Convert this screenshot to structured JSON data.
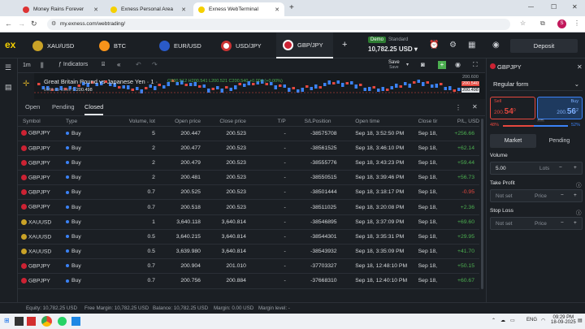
{
  "browser": {
    "tabs": [
      {
        "title": "Money Rains Forever",
        "color": "#d33"
      },
      {
        "title": "Exness Personal Area",
        "color": "#f5d000"
      },
      {
        "title": "Exness WebTerminal",
        "color": "#f5d000"
      }
    ],
    "new_tab": "+",
    "url": "my.exness.com/webtrading/",
    "profile_initial": "S"
  },
  "header": {
    "logo": "ex",
    "instruments": [
      {
        "name": "XAU/USD",
        "color": "#c9a227"
      },
      {
        "name": "BTC",
        "color": "#f7931a"
      },
      {
        "name": "EUR/USD",
        "color": "#2a5ac7"
      },
      {
        "name": "USD/JPY",
        "color": "#ffffff"
      },
      {
        "name": "GBP/JPY",
        "color": "#cc2233"
      }
    ],
    "add": "+",
    "account_type": "Demo",
    "account_kind": "Standard",
    "balance": "10,782.25 USD",
    "deposit": "Deposit"
  },
  "chart": {
    "interval": "1m",
    "indicators": "Indicators",
    "save": "Save",
    "save_sub": "Save",
    "title": "Great Britain Pound vs Japanese Yen · 1 ·",
    "ohlc": "O200.512 H200.541 L200.521 C200.540 +0.004 (+0.00%)",
    "ema": "EMA no close 9",
    "ema_value": "200.498",
    "price_top": "200.600",
    "price_red": "200.540",
    "price_white": "200.498"
  },
  "orders": {
    "tabs": [
      "Open",
      "Pending",
      "Closed"
    ],
    "active_tab": "Closed",
    "columns": [
      "Symbol",
      "Type",
      "Volume, lot",
      "Open price",
      "Close price",
      "T/P",
      "S/L",
      "Position",
      "Open time",
      "Close tir",
      "P/L, USD"
    ],
    "rows": [
      [
        "GBPJPY",
        "Buy",
        "5",
        "200.447",
        "200.523",
        "-",
        "-",
        "38575708",
        "Sep 18, 3:52:50 PM",
        "Sep 18,",
        "+256.66"
      ],
      [
        "GBPJPY",
        "Buy",
        "2",
        "200.477",
        "200.523",
        "-",
        "-",
        "38561525",
        "Sep 18, 3:46:10 PM",
        "Sep 18,",
        "+62.14"
      ],
      [
        "GBPJPY",
        "Buy",
        "2",
        "200.479",
        "200.523",
        "-",
        "-",
        "38555776",
        "Sep 18, 3:43:23 PM",
        "Sep 18,",
        "+59.44"
      ],
      [
        "GBPJPY",
        "Buy",
        "2",
        "200.481",
        "200.523",
        "-",
        "-",
        "38550515",
        "Sep 18, 3:39:46 PM",
        "Sep 18,",
        "+56.73"
      ],
      [
        "GBPJPY",
        "Buy",
        "0.7",
        "200.525",
        "200.523",
        "-",
        "-",
        "38501444",
        "Sep 18, 3:18:17 PM",
        "Sep 18,",
        "-0.95"
      ],
      [
        "GBPJPY",
        "Buy",
        "0.7",
        "200.518",
        "200.523",
        "-",
        "-",
        "38511025",
        "Sep 18, 3:20:08 PM",
        "Sep 18,",
        "+2.36"
      ],
      [
        "XAUUSD",
        "Buy",
        "1",
        "3,640.118",
        "3,640.814",
        "-",
        "-",
        "38546895",
        "Sep 18, 3:37:09 PM",
        "Sep 18,",
        "+69.60"
      ],
      [
        "XAUUSD",
        "Buy",
        "0.5",
        "3,640.215",
        "3,640.814",
        "-",
        "-",
        "38544301",
        "Sep 18, 3:35:31 PM",
        "Sep 18,",
        "+29.95"
      ],
      [
        "XAUUSD",
        "Buy",
        "0.5",
        "3,639.980",
        "3,640.814",
        "-",
        "-",
        "38543932",
        "Sep 18, 3:35:09 PM",
        "Sep 18,",
        "+41.70"
      ],
      [
        "GBPJPY",
        "Buy",
        "0.7",
        "200.904",
        "201.010",
        "-",
        "-",
        "37703327",
        "Sep 18, 12:48:10 PM",
        "Sep 18,",
        "+50.15"
      ],
      [
        "GBPJPY",
        "Buy",
        "0.7",
        "200.756",
        "200.884",
        "-",
        "-",
        "37668310",
        "Sep 18, 12:40:10 PM",
        "Sep 18,",
        "+60.67"
      ]
    ]
  },
  "panel": {
    "symbol": "GBPJPY",
    "form": "Regular form",
    "sell_label": "Sell",
    "sell_price_a": "200.",
    "sell_price_b": "54",
    "sell_price_c": "0",
    "spread": "2.2",
    "buy_label": "Buy",
    "buy_price_a": "200.",
    "buy_price_b": "56",
    "buy_price_c": "2",
    "sell_pct": "48%",
    "buy_pct": "52%",
    "buy_ratio": 0.52,
    "market": "Market",
    "pending": "Pending",
    "volume_label": "Volume",
    "volume_value": "5.00",
    "volume_unit": "Lots",
    "tp_label": "Take Profit",
    "tp_placeholder": "Not set",
    "tp_unit": "Price",
    "sl_label": "Stop Loss",
    "sl_placeholder": "Not set",
    "sl_unit": "Price",
    "minus": "−",
    "plus": "+"
  },
  "status": {
    "equity": "Equity: 10,782.25 USD",
    "free_margin": "Free Margin: 10,782.25 USD",
    "balance": "Balance: 10,782.25 USD",
    "margin": "Margin: 0.00 USD",
    "margin_level": "Margin level: -"
  },
  "taskbar": {
    "lang": "ENG",
    "time": "09:29 PM",
    "date": "18-09-2025"
  }
}
